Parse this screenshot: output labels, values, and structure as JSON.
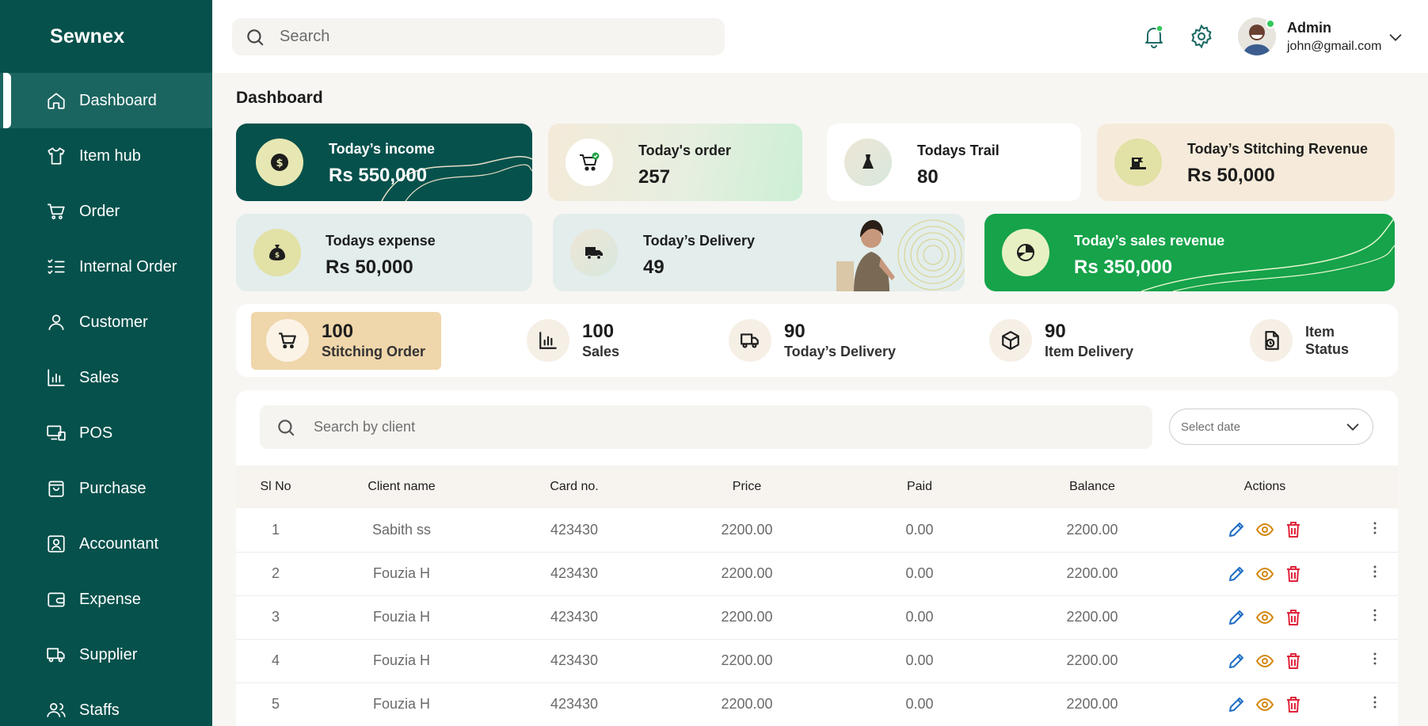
{
  "app": {
    "name": "Sewnex"
  },
  "sidebar": {
    "items": [
      {
        "label": "Dashboard",
        "icon": "home-icon"
      },
      {
        "label": "Item hub",
        "icon": "shirt-icon"
      },
      {
        "label": "Order",
        "icon": "cart-icon"
      },
      {
        "label": "Internal Order",
        "icon": "checklist-icon"
      },
      {
        "label": "Customer",
        "icon": "user-icon"
      },
      {
        "label": "Sales",
        "icon": "bar-chart-icon"
      },
      {
        "label": "POS",
        "icon": "pos-icon"
      },
      {
        "label": "Purchase",
        "icon": "bag-icon"
      },
      {
        "label": "Accountant",
        "icon": "contact-card-icon"
      },
      {
        "label": "Expense",
        "icon": "wallet-icon"
      },
      {
        "label": "Supplier",
        "icon": "truck-icon"
      },
      {
        "label": "Staffs",
        "icon": "users-icon"
      }
    ]
  },
  "topbar": {
    "search_placeholder": "Search",
    "user": {
      "name": "Admin",
      "email": "john@gmail.com"
    }
  },
  "page": {
    "title": "Dashboard"
  },
  "cards": {
    "income": {
      "label": "Today’s income",
      "value": "Rs 550,000"
    },
    "order": {
      "label": "Today's order",
      "value": "257"
    },
    "trail": {
      "label": "Todays Trail",
      "value": "80"
    },
    "stitching_revenue": {
      "label": "Today’s Stitching Revenue",
      "value": "Rs 50,000"
    },
    "expense": {
      "label": "Todays expense",
      "value": "Rs 50,000"
    },
    "delivery": {
      "label": "Today’s Delivery",
      "value": "49"
    },
    "sales_revenue": {
      "label": "Today’s sales revenue",
      "value": "Rs 350,000"
    }
  },
  "stats": [
    {
      "number": "100",
      "label": "Stitching Order"
    },
    {
      "number": "100",
      "label": "Sales"
    },
    {
      "number": "90",
      "label": "Today’s Delivery"
    },
    {
      "number": "90",
      "label": "Item Delivery"
    },
    {
      "label_line1": "Item",
      "label_line2": "Status"
    }
  ],
  "table": {
    "search_placeholder": "Search by client",
    "date_placeholder": "Select date",
    "headers": [
      "Sl No",
      "Client name",
      "Card no.",
      "Price",
      "Paid",
      "Balance",
      "Actions"
    ],
    "rows": [
      {
        "sl": "1",
        "client": "Sabith ss",
        "card": "423430",
        "price": "2200.00",
        "paid": "0.00",
        "balance": "2200.00"
      },
      {
        "sl": "2",
        "client": "Fouzia H",
        "card": "423430",
        "price": "2200.00",
        "paid": "0.00",
        "balance": "2200.00"
      },
      {
        "sl": "3",
        "client": "Fouzia H",
        "card": "423430",
        "price": "2200.00",
        "paid": "0.00",
        "balance": "2200.00"
      },
      {
        "sl": "4",
        "client": "Fouzia H",
        "card": "423430",
        "price": "2200.00",
        "paid": "0.00",
        "balance": "2200.00"
      },
      {
        "sl": "5",
        "client": "Fouzia H",
        "card": "423430",
        "price": "2200.00",
        "paid": "0.00",
        "balance": "2200.00"
      }
    ]
  },
  "colors": {
    "sidebar": "#06514c",
    "income_card": "#06514c",
    "sales_card": "#16a34a",
    "edit": "#1f6fc5",
    "view": "#d4870f",
    "delete": "#e0243a"
  }
}
